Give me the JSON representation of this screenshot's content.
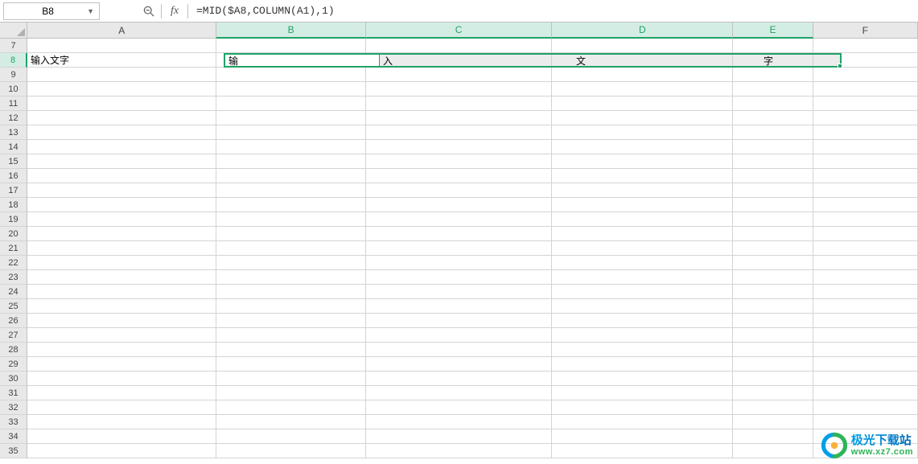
{
  "formula_bar": {
    "name_box": "B8",
    "formula": "=MID($A8,COLUMN(A1),1)",
    "fx_label": "fx"
  },
  "columns": [
    {
      "label": "A",
      "width_class": "w-A",
      "selected": false
    },
    {
      "label": "B",
      "width_class": "w-B",
      "selected": true
    },
    {
      "label": "C",
      "width_class": "w-C",
      "selected": true
    },
    {
      "label": "D",
      "width_class": "w-D",
      "selected": true
    },
    {
      "label": "E",
      "width_class": "w-E",
      "selected": true
    },
    {
      "label": "F",
      "width_class": "w-F",
      "selected": false
    }
  ],
  "rows": [
    {
      "num": 7,
      "selected": false
    },
    {
      "num": 8,
      "selected": true
    },
    {
      "num": 9,
      "selected": false
    },
    {
      "num": 10,
      "selected": false
    },
    {
      "num": 11,
      "selected": false
    },
    {
      "num": 12,
      "selected": false
    },
    {
      "num": 13,
      "selected": false
    },
    {
      "num": 14,
      "selected": false
    },
    {
      "num": 15,
      "selected": false
    },
    {
      "num": 16,
      "selected": false
    },
    {
      "num": 17,
      "selected": false
    },
    {
      "num": 18,
      "selected": false
    },
    {
      "num": 19,
      "selected": false
    },
    {
      "num": 20,
      "selected": false
    },
    {
      "num": 21,
      "selected": false
    },
    {
      "num": 22,
      "selected": false
    },
    {
      "num": 23,
      "selected": false
    },
    {
      "num": 24,
      "selected": false
    },
    {
      "num": 25,
      "selected": false
    },
    {
      "num": 26,
      "selected": false
    },
    {
      "num": 27,
      "selected": false
    },
    {
      "num": 28,
      "selected": false
    },
    {
      "num": 29,
      "selected": false
    },
    {
      "num": 30,
      "selected": false
    },
    {
      "num": 31,
      "selected": false
    },
    {
      "num": 32,
      "selected": false
    },
    {
      "num": 33,
      "selected": false
    },
    {
      "num": 34,
      "selected": false
    },
    {
      "num": 35,
      "selected": false
    }
  ],
  "cells": {
    "A8": "输入文字",
    "B8": "输",
    "C8": "入",
    "D8": "文",
    "E8": "字"
  },
  "selection": {
    "active_cell": "B8",
    "range": "B8:E8"
  },
  "colors": {
    "accent": "#1fa367",
    "grid_line": "#d4d4d4",
    "header_bg": "#e8e8e8",
    "selected_header_bg": "#d4ede4"
  },
  "watermark": {
    "line1": "极光下载站",
    "line2": "www.xz7.com"
  }
}
